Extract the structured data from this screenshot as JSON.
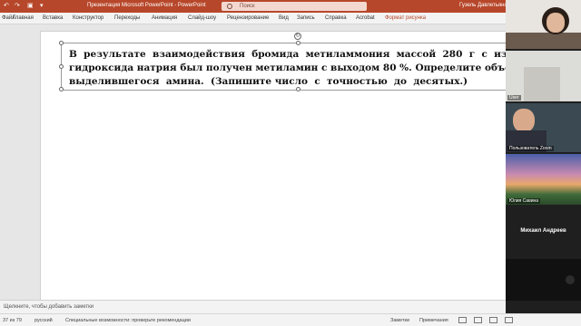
{
  "titlebar": {
    "doc_title": "Презентация Microsoft PowerPoint  -  PowerPoint",
    "search_placeholder": "Поиск",
    "user_name": "Гузель Давлетьянова"
  },
  "ribbon": {
    "tabs": [
      "Файл",
      "Главная",
      "Вставка",
      "Конструктор",
      "Переходы",
      "Анимация",
      "Слайд-шоу",
      "Рецензирование",
      "Вид",
      "Запись",
      "Справка",
      "Acrobat",
      "Формат рисунка"
    ],
    "active_tab": "Формат рисунка"
  },
  "slide": {
    "line1": "В  результате  взаимодействия  бромида  метиламмония  массой  280  г  с  избытком",
    "line2": "гидроксида натрия был получен метиламин с выходом 80 %. Определите объём (н.у.)",
    "line3": "выделившегося  амина.  (Запишите число  с  точностью  до  десятых.)"
  },
  "notes": {
    "placeholder": "Щелкните, чтобы добавить заметки"
  },
  "status": {
    "slide_counter": "37 из 79",
    "language": "русский",
    "accessibility": "Специальные возможности: проверьте рекомендации",
    "notes_label": "Заметки",
    "comments_label": "Примечания"
  },
  "participants": [
    {
      "name": ""
    },
    {
      "name": "User"
    },
    {
      "name": "Пользователь Zoom"
    },
    {
      "name": "Юлия Савина"
    },
    {
      "name": "Михаил Андреев"
    },
    {
      "name": ""
    }
  ],
  "colors": {
    "accent": "#b7472a",
    "ribbon_bg": "#f3f3f3",
    "work_bg": "#e6e6e6",
    "video_bg": "#1f1f1f"
  },
  "icons": [
    "undo-icon",
    "redo-icon",
    "save-icon",
    "search-icon",
    "rotate-handle-icon"
  ]
}
